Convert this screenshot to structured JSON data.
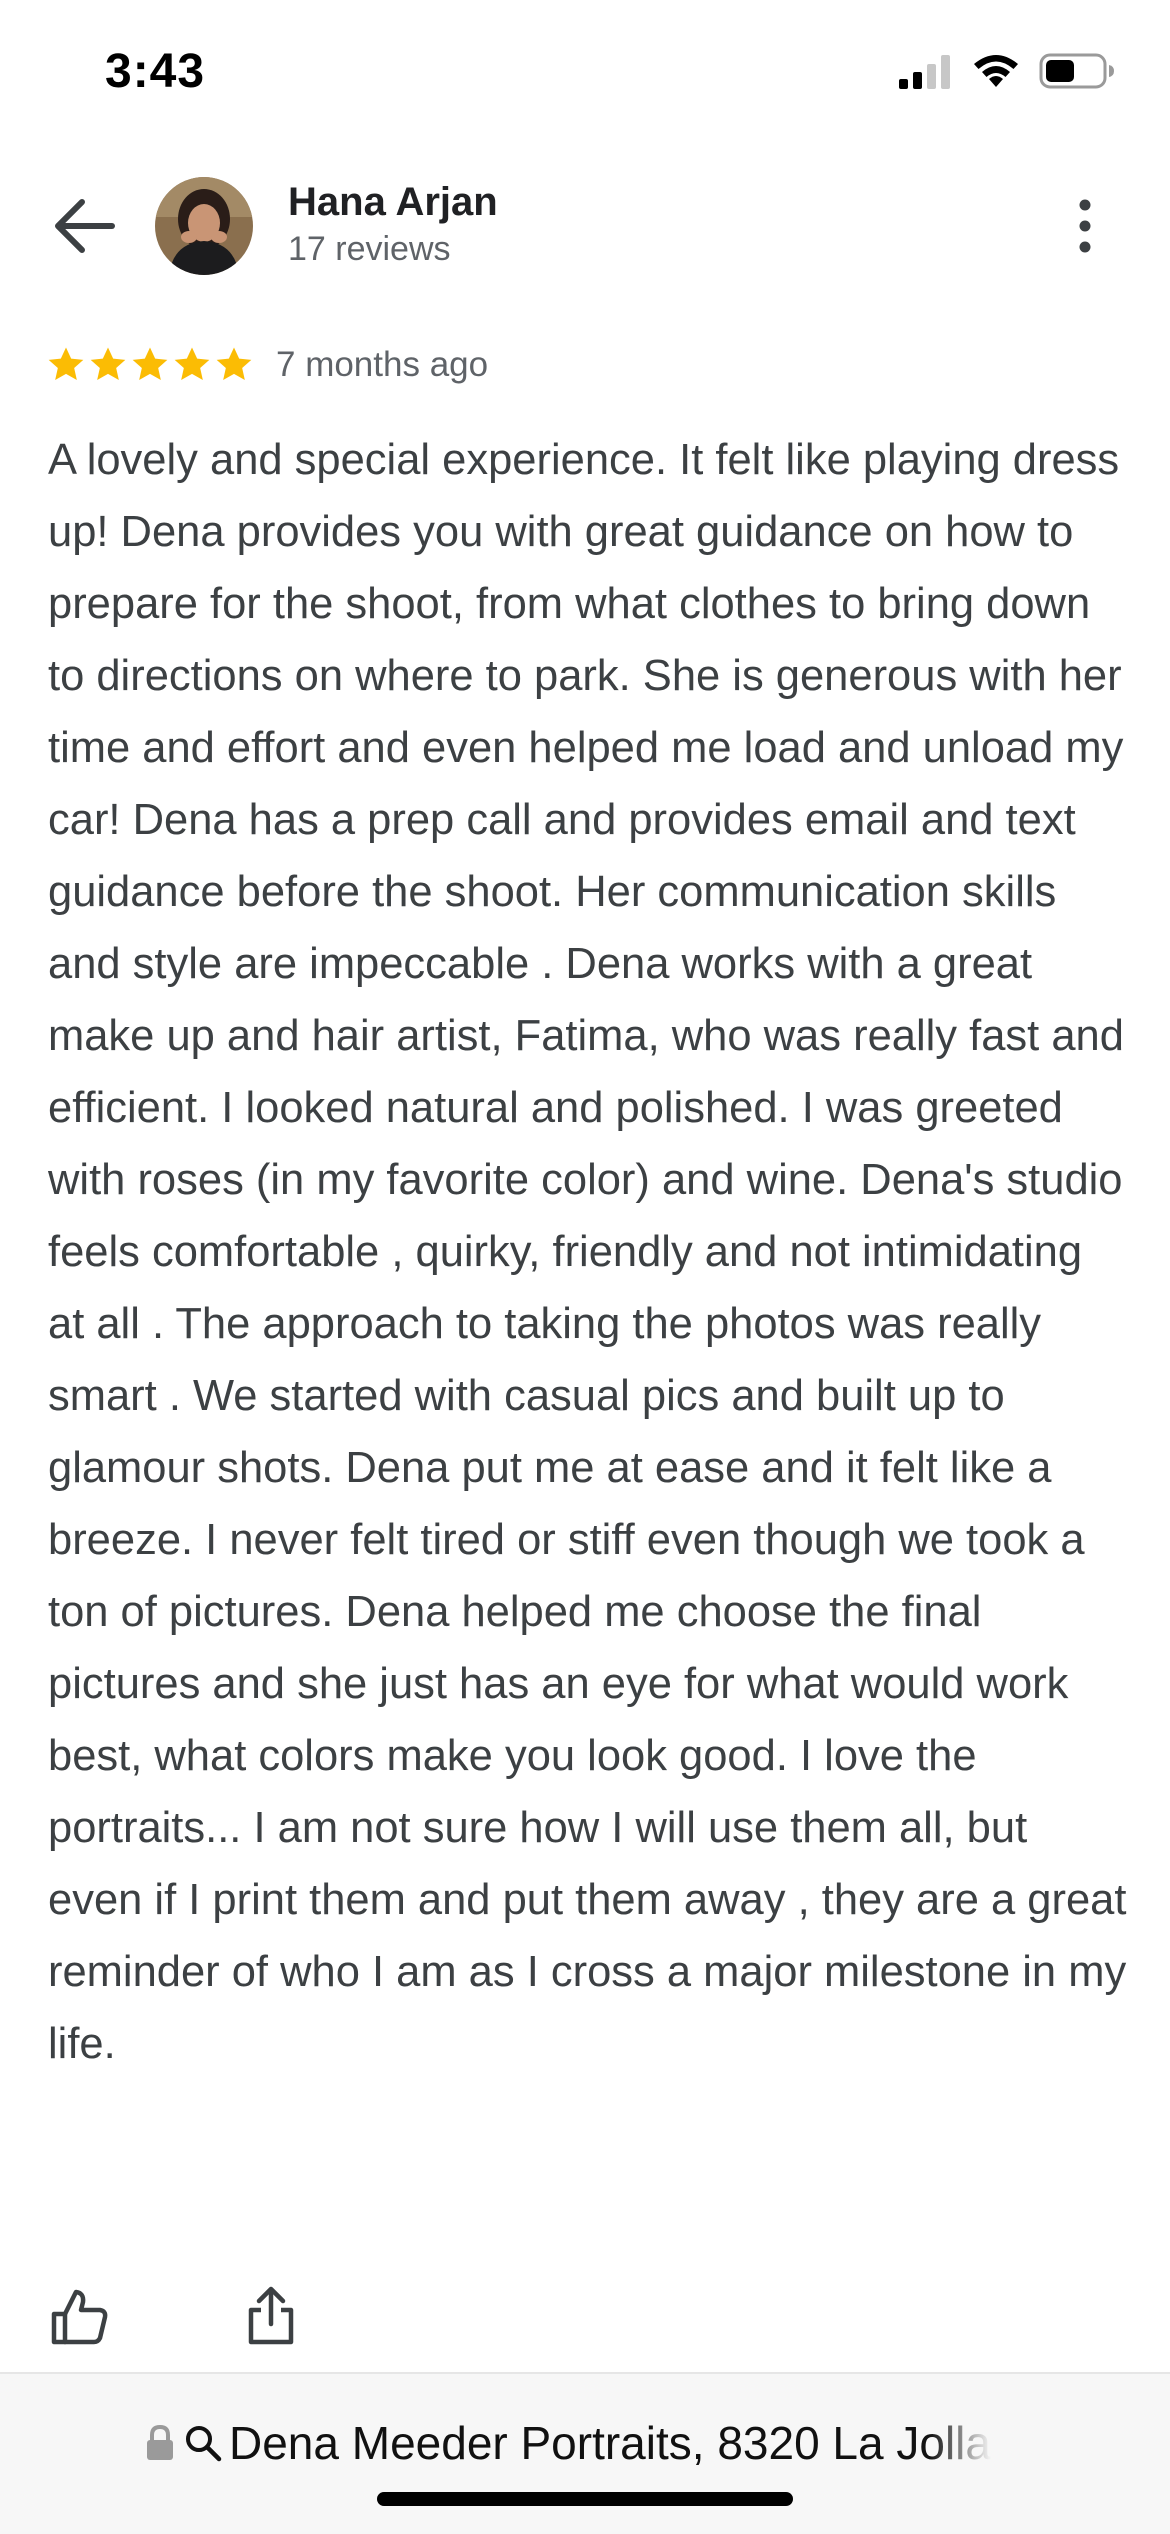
{
  "status_bar": {
    "time": "3:43",
    "icons": [
      "cellular-signal-icon",
      "wifi-icon",
      "battery-icon"
    ]
  },
  "header": {
    "back_icon": "arrow-left-icon",
    "reviewer_name": "Hana Arjan",
    "review_count": "17 reviews",
    "more_icon": "more-vertical-icon"
  },
  "review": {
    "rating": 5,
    "max_rating": 5,
    "star_color": "#fbbc04",
    "time_ago": "7 months ago",
    "text": "A lovely and special experience. It felt like playing dress up! Dena provides you with great guidance on how to prepare for the shoot, from what clothes to bring down to directions on where to park. She is generous with her time and effort and even helped me load and unload my car! Dena has a prep call and provides email and text guidance before the shoot. Her communication skills and style are impeccable . Dena works with a great make up and hair artist, Fatima, who was really fast and efficient. I looked natural and polished. I was greeted with roses (in my favorite color) and wine. Dena's studio feels comfortable , quirky, friendly and not intimidating at all . The approach to taking the photos was really smart . We started with casual pics and built up to glamour shots. Dena put me at ease and it felt like a breeze. I never felt tired or stiff even though we took a ton of pictures. Dena helped me choose the final pictures and she just has an eye for what would work best, what colors make you look good. I love the portraits... I am not sure how I will use them all, but even if I print them and put them away , they are a great reminder of who I am as I cross a major milestone in my life."
  },
  "actions": {
    "like_icon": "thumbs-up-icon",
    "share_icon": "share-icon"
  },
  "browser": {
    "lock_icon": "lock-icon",
    "search_icon": "search-icon",
    "url_text": "Dena Meeder Portraits, 8320 La Jolla"
  }
}
